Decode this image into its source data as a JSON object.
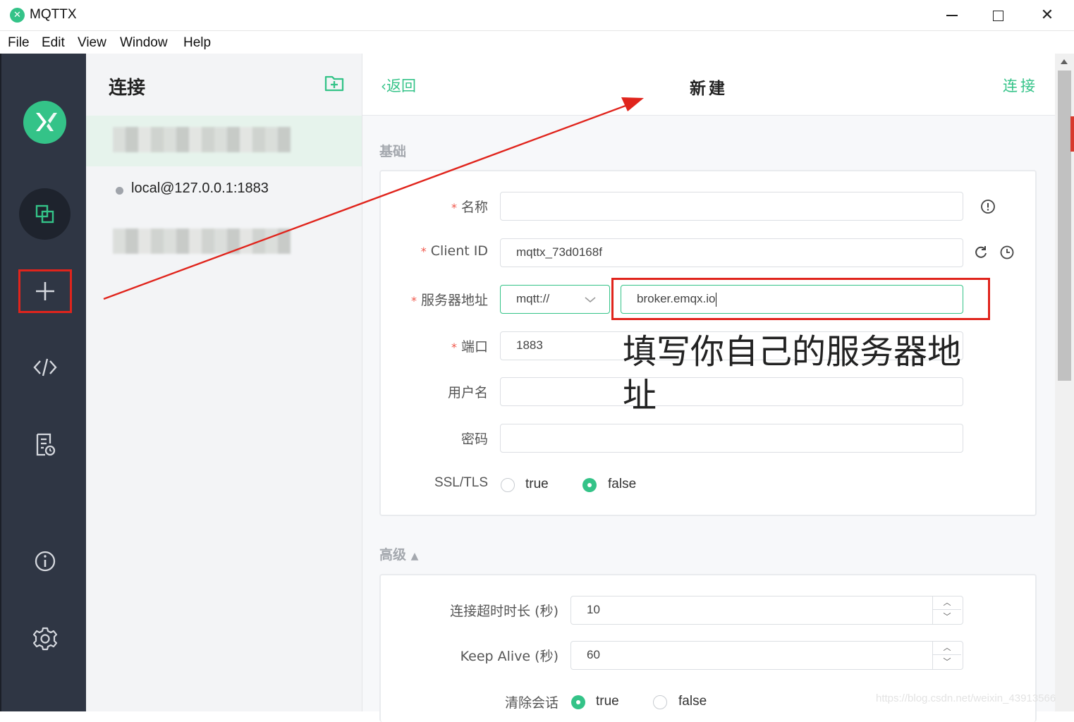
{
  "window": {
    "title": "MQTTX",
    "app_icon_glyph": "✕"
  },
  "menu": [
    "File",
    "Edit",
    "View",
    "Window",
    "Help"
  ],
  "nav": {
    "items": [
      "logo",
      "connections-icon",
      "plus-icon",
      "code-icon",
      "log-icon",
      "info-icon",
      "gear-icon"
    ]
  },
  "connections": {
    "title": "连接",
    "items": [
      {
        "label": "",
        "status": "blurred"
      },
      {
        "label": "local@127.0.0.1:1883",
        "status": "offline"
      },
      {
        "label": "",
        "status": "blurred"
      }
    ]
  },
  "header": {
    "back": "返回",
    "title": "新建",
    "connect": "连接"
  },
  "basic": {
    "section": "基础",
    "name_label": "名称",
    "name_value": "",
    "client_id_label": "Client ID",
    "client_id_value": "mqttx_73d0168f",
    "host_label": "服务器地址",
    "protocol_value": "mqtt://",
    "host_value": "broker.emqx.io",
    "port_label": "端口",
    "port_value": "1883",
    "username_label": "用户名",
    "username_value": "",
    "password_label": "密码",
    "password_value": "",
    "ssl_label": "SSL/TLS",
    "ssl_true": "true",
    "ssl_false": "false",
    "ssl_selected": "false"
  },
  "advanced": {
    "section": "高级",
    "timeout_label": "连接超时时长 (秒)",
    "timeout_value": "10",
    "keepalive_label": "Keep Alive (秒)",
    "keepalive_value": "60",
    "clean_label": "清除会话",
    "clean_true": "true",
    "clean_false": "false",
    "clean_selected": "true"
  },
  "annotation": {
    "text": "填写你自己的服务器地址",
    "color": "#e0241c"
  },
  "watermark": "https://blog.csdn.net/weixin_43913566",
  "colors": {
    "accent": "#34c388",
    "nav_bg": "#2f3644",
    "annotation_red": "#e0241c"
  }
}
